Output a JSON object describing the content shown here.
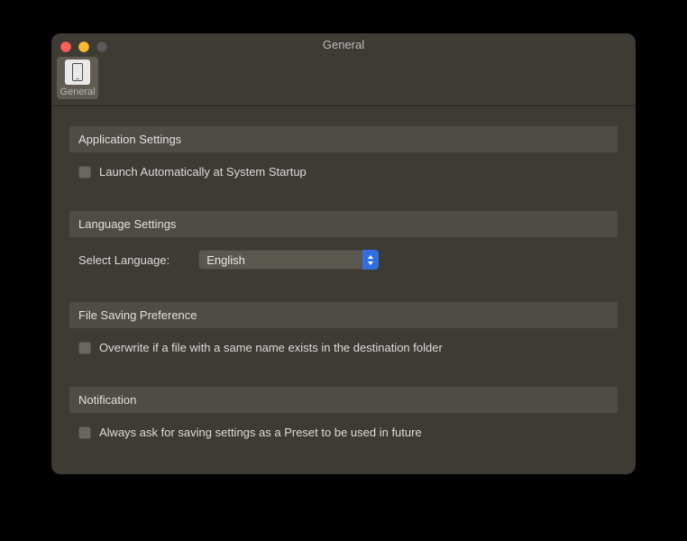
{
  "window": {
    "title": "General"
  },
  "toolbar": {
    "general_tab": "General"
  },
  "sections": {
    "application": {
      "header": "Application Settings",
      "launch_at_startup": "Launch Automatically at System Startup"
    },
    "language": {
      "header": "Language Settings",
      "select_label": "Select Language:",
      "selected": "English"
    },
    "file_saving": {
      "header": "File Saving Preference",
      "overwrite": "Overwrite if a file with a same name exists in the destination folder"
    },
    "notification": {
      "header": "Notification",
      "always_ask_preset": "Always ask for saving settings as a Preset to be used in future"
    }
  }
}
